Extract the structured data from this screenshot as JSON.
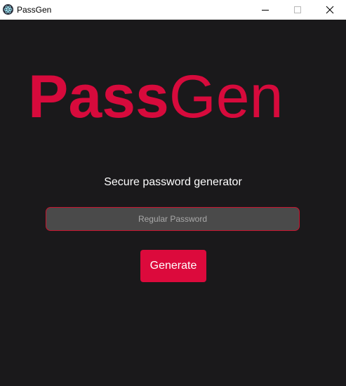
{
  "window": {
    "title": "PassGen",
    "app_icon": "electron-icon",
    "controls": [
      "minimize-icon",
      "maximize-icon",
      "close-icon"
    ]
  },
  "logo": {
    "bold_part": "Pass",
    "thin_part": "Gen",
    "color": "#d70a3c"
  },
  "main": {
    "subtitle": "Secure password generator",
    "password_field": {
      "placeholder": "Regular Password",
      "value": ""
    },
    "generate_label": "Generate"
  },
  "colors": {
    "background": "#1a191b",
    "accent": "#dc0a3c",
    "field_background": "#4a4a4a",
    "field_border": "#c7142f"
  }
}
